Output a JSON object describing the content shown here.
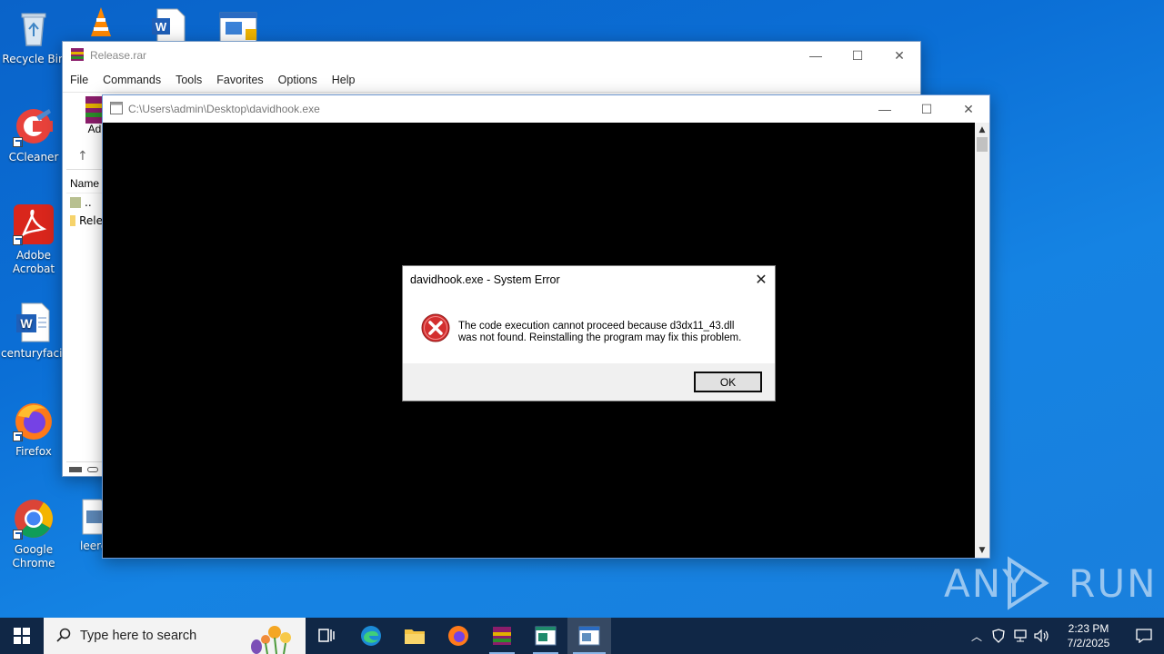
{
  "desktop": {
    "icons": [
      {
        "label": "Recycle Bin"
      },
      {
        "label": "CCleaner"
      },
      {
        "label": "Adobe Acrobat"
      },
      {
        "label": "centuryfaci..."
      },
      {
        "label": "Firefox"
      },
      {
        "label": "Google Chrome"
      },
      {
        "label": "leere"
      }
    ],
    "watermark": "ANY RUN"
  },
  "winrar": {
    "title": "Release.rar",
    "menu": [
      "File",
      "Commands",
      "Tools",
      "Favorites",
      "Options",
      "Help"
    ],
    "toolbar_partial_label": "Ad",
    "column_name": "Name",
    "rows": [
      "..",
      "Rele"
    ]
  },
  "console": {
    "title": "C:\\Users\\admin\\Desktop\\davidhook.exe"
  },
  "error_dialog": {
    "title": "davidhook.exe - System Error",
    "message_line1": "The code execution cannot proceed because d3dx11_43.dll",
    "message_line2": "was not found. Reinstalling the program may fix this problem.",
    "ok_label": "OK",
    "icon": "error-icon",
    "accent_color": "#d32f2f"
  },
  "taskbar": {
    "search_placeholder": "Type here to search",
    "time": "2:23 PM",
    "date": "7/2/2025"
  }
}
